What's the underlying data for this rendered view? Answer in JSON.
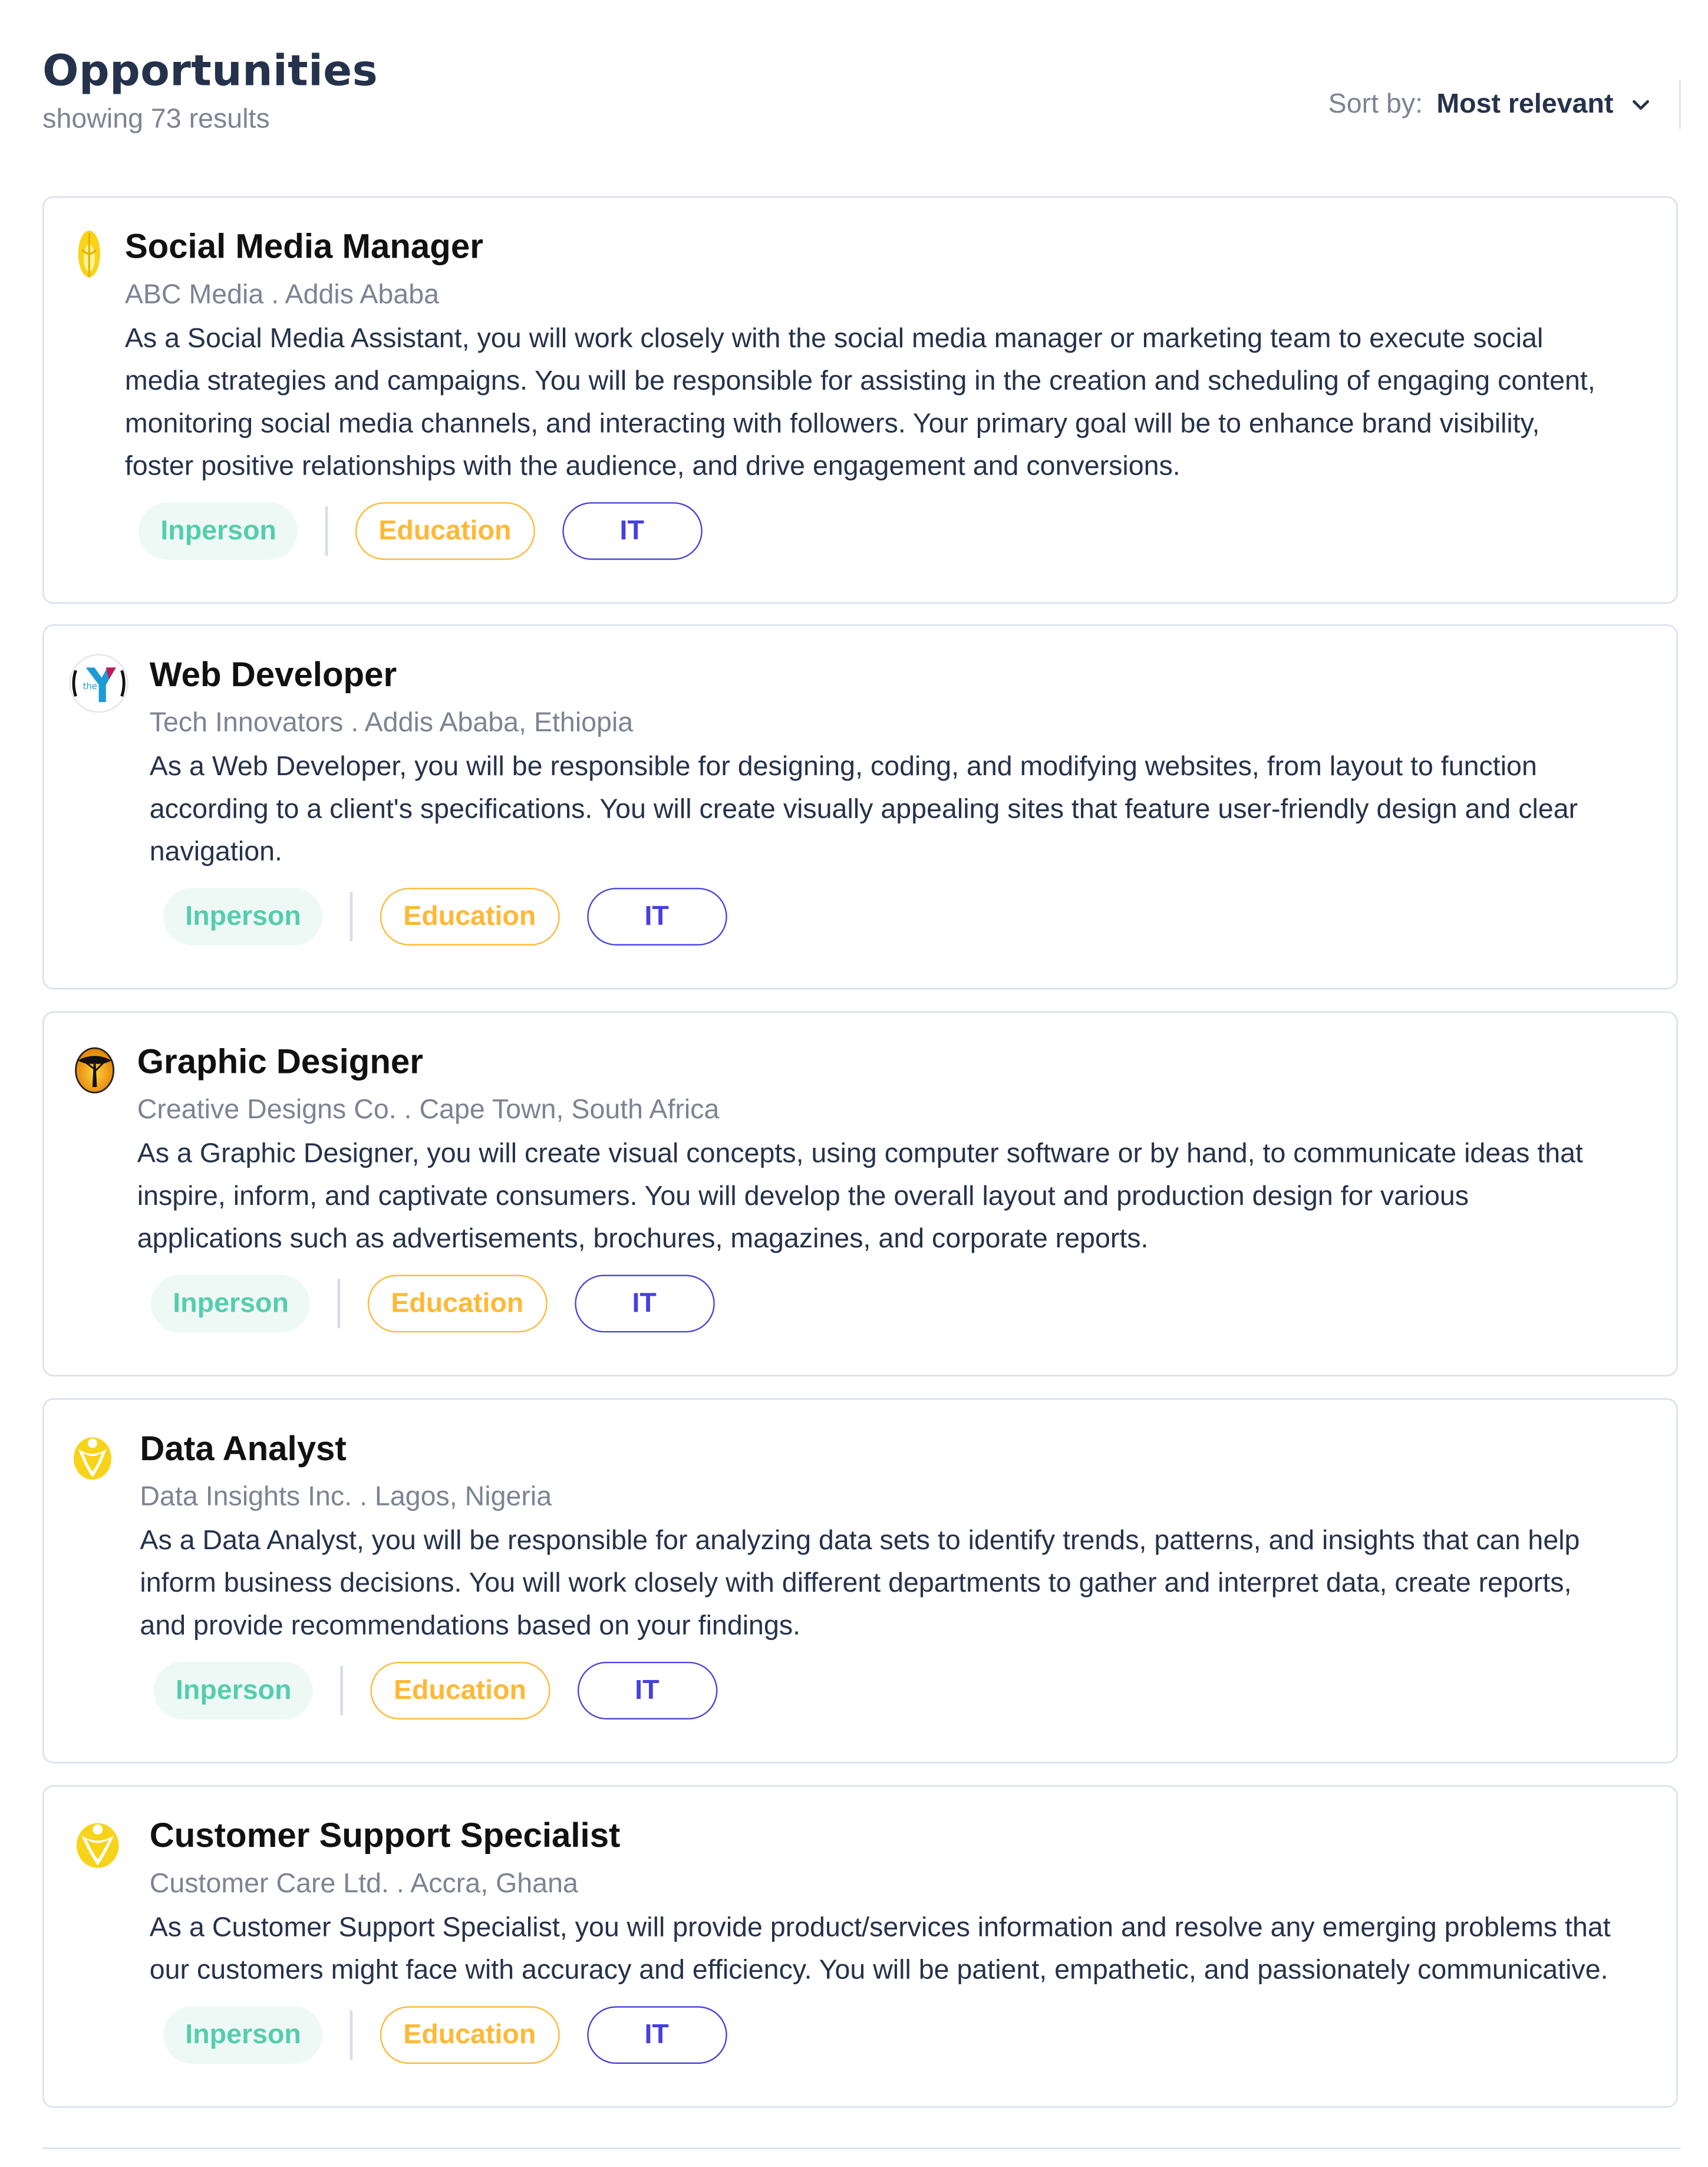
{
  "header": {
    "title": "Opportunities",
    "results": "showing 73 results",
    "sort_label": "Sort by:",
    "sort_value": "Most relevant",
    "sort_icon": "chevron-down-icon"
  },
  "colors": {
    "title": "#25324B",
    "muted": "#7C8493",
    "inperson": "#56CDAD",
    "education": "#FFB836",
    "it": "#4640DE",
    "border": "#D6DDEB"
  },
  "jobs": [
    {
      "title": "Social Media Manager",
      "meta": "ABC Media . Addis Ababa",
      "description_lines": [
        "As a Social Media Assistant, you will work closely with the social media manager or marketing team to execute social",
        "media strategies and campaigns. You will be responsible for assisting in the creation and scheduling of engaging content,",
        "monitoring social media channels, and interacting with followers. Your primary goal will be to enhance brand visibility,",
        "foster positive relationships with the audience, and drive engagement and conversions."
      ],
      "logo": "yellow-leaf-logo-icon",
      "tags": [
        "Inperson",
        "Education",
        "IT"
      ]
    },
    {
      "title": "Web Developer",
      "meta": "Tech Innovators . Addis Ababa, Ethiopia",
      "description_lines": [
        "As a Web Developer, you will be responsible for designing, coding, and modifying websites, from layout to function",
        "according to a client's specifications. You will create visually appealing sites that feature user-friendly design and clear",
        "navigation."
      ],
      "logo": "ymca-logo-icon",
      "logo_text": "the",
      "tags": [
        "Inperson",
        "Education",
        "IT"
      ]
    },
    {
      "title": "Graphic Designer",
      "meta": "Creative Designs Co. . Cape Town, South Africa",
      "description_lines": [
        "As a Graphic Designer, you will create visual concepts, using computer software or by hand, to communicate ideas that",
        "inspire, inform, and captivate consumers. You will develop the overall layout and production design for various",
        "applications such as advertisements, brochures, magazines, and corporate reports."
      ],
      "logo": "tree-sunset-logo-icon",
      "tags": [
        "Inperson",
        "Education",
        "IT"
      ]
    },
    {
      "title": "Data Analyst",
      "meta": "Data Insights Inc. . Lagos, Nigeria",
      "description_lines": [
        "As a Data Analyst, you will be responsible for analyzing data sets to identify trends, patterns, and insights that can help",
        "inform business decisions. You will work closely with different departments to gather and interpret data, create reports,",
        "and provide recommendations based on your findings."
      ],
      "logo": "yellow-person-logo-icon",
      "tags": [
        "Inperson",
        "Education",
        "IT"
      ]
    },
    {
      "title": "Customer Support Specialist",
      "meta": "Customer Care Ltd. . Accra, Ghana",
      "description_lines": [
        "As a Customer Support Specialist, you will provide product/services information and resolve any emerging problems that",
        "our customers might face with accuracy and efficiency. You will be patient, empathetic, and passionately communicative."
      ],
      "logo": "yellow-person-logo-icon",
      "tags": [
        "Inperson",
        "Education",
        "IT"
      ]
    }
  ]
}
